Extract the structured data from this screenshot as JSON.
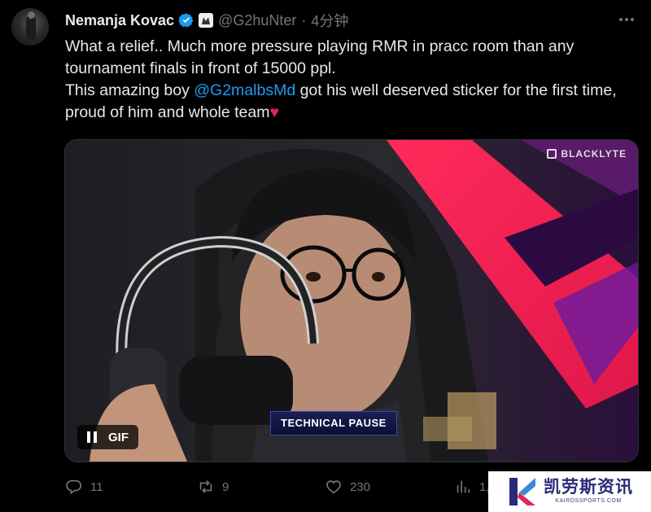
{
  "tweet": {
    "author_name": "Nemanja Kovac",
    "handle": "@G2huNter",
    "separator": "·",
    "time": "4分钟",
    "more_icon": "more-icon",
    "line1": "What a relief.. Much more pressure playing RMR in pracc room than any tournament finals in front of 15000 ppl.",
    "line2_prefix": "This amazing boy ",
    "mention": "@G2malbsMd",
    "line2_suffix": "  got his well deserved sticker for the first time, proud of him and whole team",
    "heart": "♥"
  },
  "media": {
    "sponsor_label": "BLACKLYTE",
    "overlay_text": "TECHNICAL PAUSE",
    "gif_label": "GIF",
    "pause_icon": "pause-icon"
  },
  "actions": {
    "replies": "11",
    "retweets": "9",
    "likes": "230",
    "views": "1,"
  },
  "watermark": {
    "cn": "凯劳斯资讯",
    "en": "KAIROSSPORTS.COM"
  },
  "colors": {
    "accent": "#1d9bf0",
    "muted": "#71767b",
    "text": "#e7e9ea",
    "background": "#000000"
  }
}
